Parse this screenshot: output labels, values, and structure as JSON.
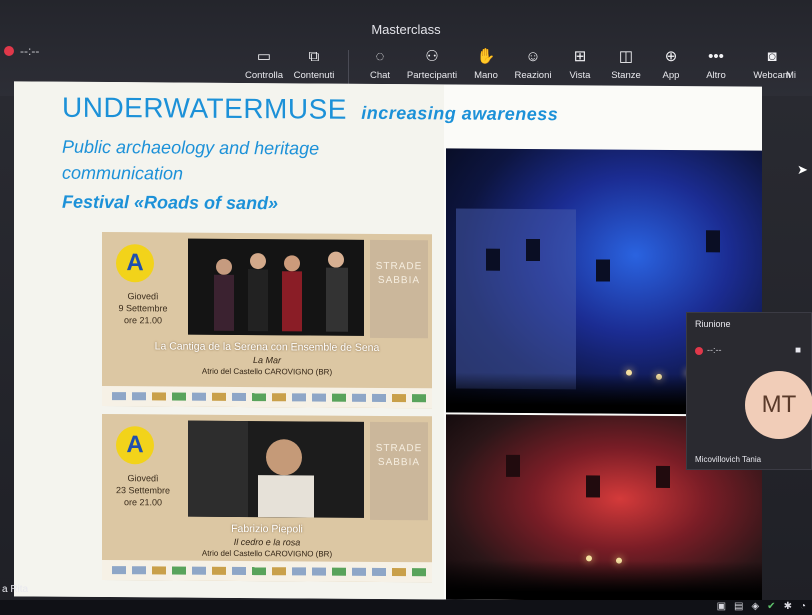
{
  "window": {
    "title": "Masterclass",
    "timer": "--:--"
  },
  "toolbar": [
    {
      "label": "Controlla",
      "icon": "control-icon",
      "glyph": "▭"
    },
    {
      "label": "Contenuti",
      "icon": "share-content-icon",
      "glyph": "⧉"
    },
    {
      "label": "Chat",
      "icon": "chat-icon",
      "glyph": "◌"
    },
    {
      "label": "Partecipanti",
      "icon": "participants-icon",
      "glyph": "⚇"
    },
    {
      "label": "Mano",
      "icon": "hand-icon",
      "glyph": "✋"
    },
    {
      "label": "Reazioni",
      "icon": "reactions-icon",
      "glyph": "☺"
    },
    {
      "label": "Vista",
      "icon": "view-icon",
      "glyph": "⊞"
    },
    {
      "label": "Stanze",
      "icon": "rooms-icon",
      "glyph": "◫"
    },
    {
      "label": "App",
      "icon": "apps-icon",
      "glyph": "⊕"
    },
    {
      "label": "Altro",
      "icon": "more-icon",
      "glyph": "•••"
    },
    {
      "label": "Webcam",
      "icon": "webcam-icon",
      "glyph": "◙"
    },
    {
      "label": "Mi",
      "icon": "mic-icon",
      "glyph": ""
    }
  ],
  "slide": {
    "title": "UNDERWATERMUSE",
    "title_sub": "increasing awareness",
    "line1": "Public archaeology and heritage",
    "line2": "communication",
    "festival": "Festival «Roads of sand»",
    "accent": "#1c91d8",
    "posters": [
      {
        "logo": "A",
        "day": "Giovedì",
        "date": "9 Settembre",
        "time": "ore 21.00",
        "side": "STRADE SABBIA",
        "title": "La Cantiga de la Serena con Ensemble de Sena",
        "subtitle": "La Mar",
        "location": "Atrio del Castello CAROVIGNO (BR)"
      },
      {
        "logo": "A",
        "day": "Giovedì",
        "date": "23 Settembre",
        "time": "ore 21.00",
        "side": "STRADE SABBIA",
        "title": "Fabrizio Piepoli",
        "subtitle": "Il cedro e la rosa",
        "location": "Atrio del Castello CAROVIGNO (BR)"
      }
    ]
  },
  "participant": {
    "panel_title": "Riunione",
    "timer": "--:--",
    "initials": "MT",
    "name": "Micovillovich Tania",
    "avatar_color": "#f1cdb8"
  },
  "bottom": {
    "name": "a Rita"
  }
}
